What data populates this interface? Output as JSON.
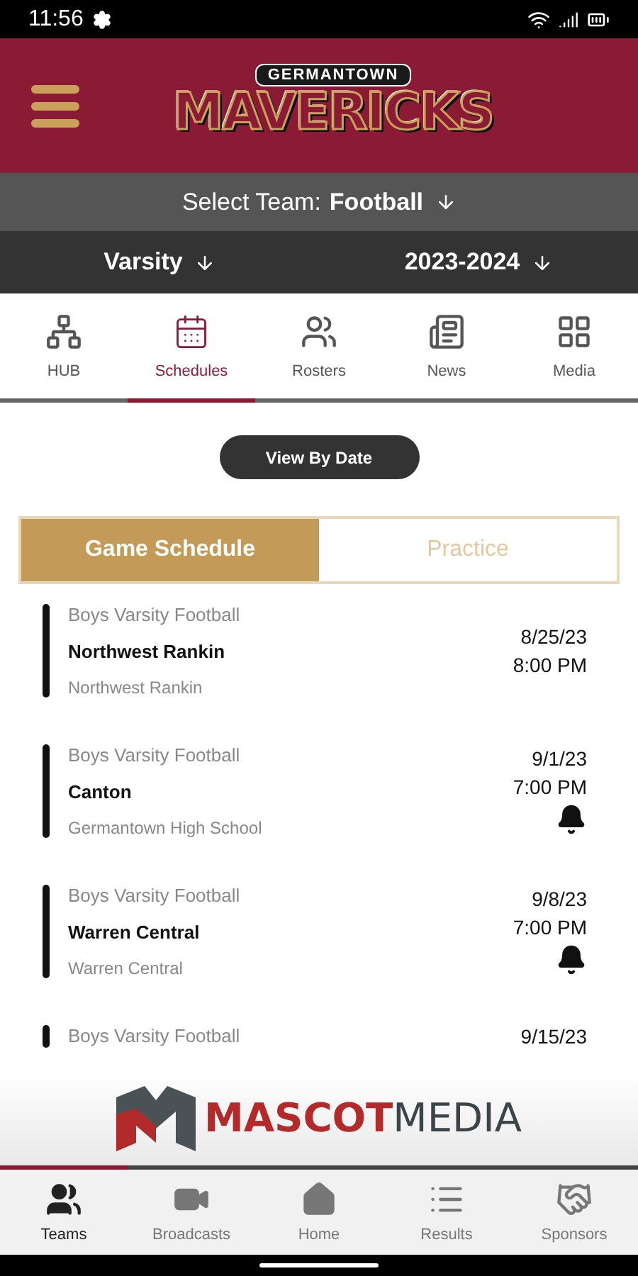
{
  "status_bar": {
    "time": "11:56"
  },
  "header": {
    "logo_top": "GERMANTOWN",
    "logo_main": "MAVERICKS"
  },
  "team_select": {
    "label": "Select Team:",
    "value": "Football"
  },
  "filters": [
    {
      "value": "Varsity"
    },
    {
      "value": "2023-2024"
    }
  ],
  "tabs": [
    {
      "kind": "hub",
      "label": "HUB",
      "selected": false
    },
    {
      "kind": "schedules",
      "label": "Schedules",
      "selected": true
    },
    {
      "kind": "rosters",
      "label": "Rosters",
      "selected": false
    },
    {
      "kind": "news",
      "label": "News",
      "selected": false
    },
    {
      "kind": "media",
      "label": "Media",
      "selected": false
    }
  ],
  "view_button": "View By Date",
  "segments": [
    {
      "label": "Game Schedule",
      "selected": true
    },
    {
      "label": "Practice",
      "selected": false
    }
  ],
  "games": [
    {
      "category": "Boys Varsity Football",
      "opponent": "Northwest Rankin",
      "location": "Northwest Rankin",
      "date": "8/25/23",
      "time": "8:00 PM",
      "alert": false
    },
    {
      "category": "Boys Varsity Football",
      "opponent": "Canton",
      "location": "Germantown High School",
      "date": "9/1/23",
      "time": "7:00 PM",
      "alert": true
    },
    {
      "category": "Boys Varsity Football",
      "opponent": "Warren Central",
      "location": "Warren Central",
      "date": "9/8/23",
      "time": "7:00 PM",
      "alert": true
    },
    {
      "category": "Boys Varsity Football",
      "date": "9/15/23"
    }
  ],
  "sponsor_banner": {
    "brand_first": "MASCOT",
    "brand_second": "MEDIA"
  },
  "bottom_nav": [
    {
      "kind": "teams",
      "label": "Teams",
      "selected": true
    },
    {
      "kind": "broadcasts",
      "label": "Broadcasts",
      "selected": false
    },
    {
      "kind": "home",
      "label": "Home",
      "selected": false
    },
    {
      "kind": "results",
      "label": "Results",
      "selected": false
    },
    {
      "kind": "sponsors",
      "label": "Sponsors",
      "selected": false
    }
  ]
}
